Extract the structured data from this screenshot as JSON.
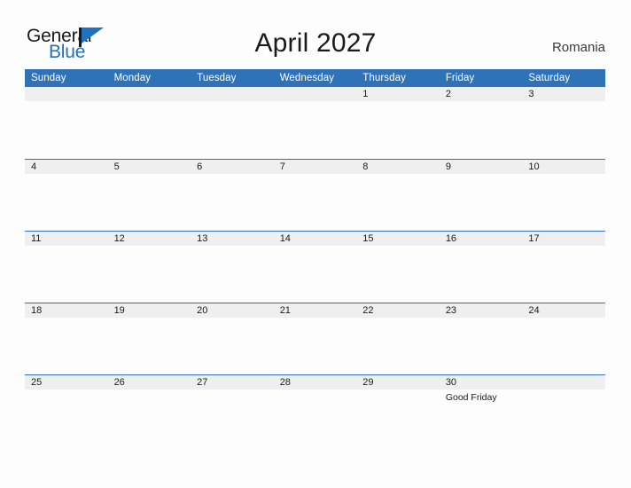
{
  "brand": {
    "name_part1": "General",
    "name_part2": "Blue",
    "flag_icon": "flag-icon",
    "color_primary": "#1f72bd",
    "color_dark": "#1a1a1a"
  },
  "header": {
    "title": "April 2027",
    "country": "Romania"
  },
  "calendar": {
    "header_background": "#2e72b8",
    "daynum_background": "#efefef",
    "weekday_headers": [
      "Sunday",
      "Monday",
      "Tuesday",
      "Wednesday",
      "Thursday",
      "Friday",
      "Saturday"
    ],
    "weeks": [
      [
        {
          "day": "",
          "events": []
        },
        {
          "day": "",
          "events": []
        },
        {
          "day": "",
          "events": []
        },
        {
          "day": "",
          "events": []
        },
        {
          "day": "1",
          "events": []
        },
        {
          "day": "2",
          "events": []
        },
        {
          "day": "3",
          "events": []
        }
      ],
      [
        {
          "day": "4",
          "events": []
        },
        {
          "day": "5",
          "events": []
        },
        {
          "day": "6",
          "events": []
        },
        {
          "day": "7",
          "events": []
        },
        {
          "day": "8",
          "events": []
        },
        {
          "day": "9",
          "events": []
        },
        {
          "day": "10",
          "events": []
        }
      ],
      [
        {
          "day": "11",
          "events": []
        },
        {
          "day": "12",
          "events": []
        },
        {
          "day": "13",
          "events": []
        },
        {
          "day": "14",
          "events": []
        },
        {
          "day": "15",
          "events": []
        },
        {
          "day": "16",
          "events": []
        },
        {
          "day": "17",
          "events": []
        }
      ],
      [
        {
          "day": "18",
          "events": []
        },
        {
          "day": "19",
          "events": []
        },
        {
          "day": "20",
          "events": []
        },
        {
          "day": "21",
          "events": []
        },
        {
          "day": "22",
          "events": []
        },
        {
          "day": "23",
          "events": []
        },
        {
          "day": "24",
          "events": []
        }
      ],
      [
        {
          "day": "25",
          "events": []
        },
        {
          "day": "26",
          "events": []
        },
        {
          "day": "27",
          "events": []
        },
        {
          "day": "28",
          "events": []
        },
        {
          "day": "29",
          "events": []
        },
        {
          "day": "30",
          "events": [
            "Good Friday"
          ]
        },
        {
          "day": "",
          "events": []
        }
      ]
    ]
  }
}
